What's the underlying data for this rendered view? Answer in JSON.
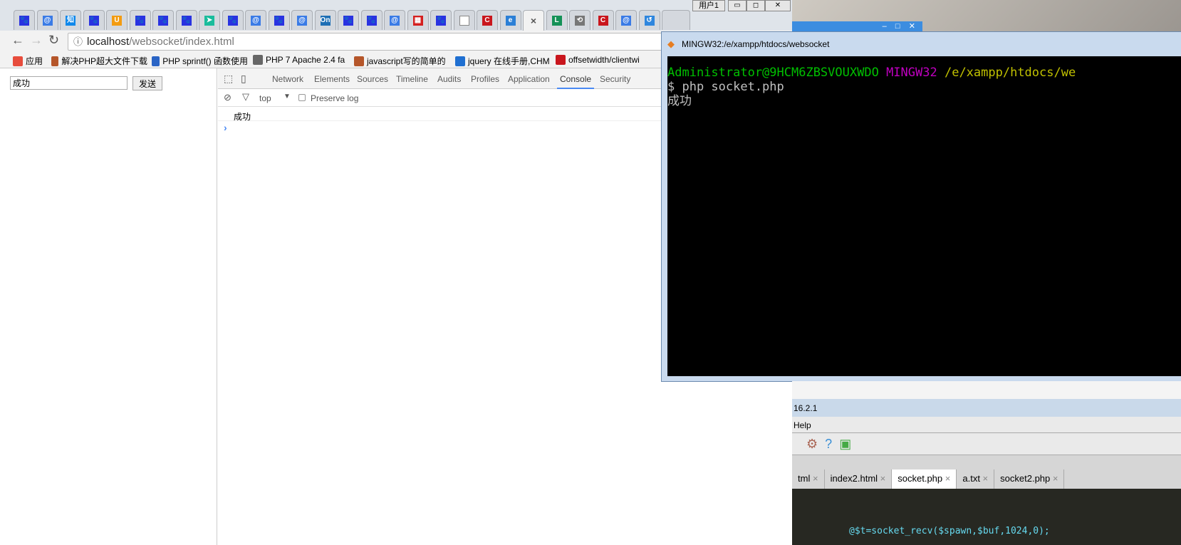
{
  "os": {
    "user_badge": "用户1",
    "minimize": "▭",
    "maximize": "◻",
    "close": "✕"
  },
  "browser": {
    "tabs": [
      {
        "icon": "baidu-paw-icon",
        "color": "#2932e1",
        "glyph": "🐾"
      },
      {
        "icon": "sogou-icon",
        "color": "#3a7be6",
        "glyph": "@"
      },
      {
        "icon": "zhihu-icon",
        "color": "#0f88eb",
        "glyph": "知"
      },
      {
        "icon": "baidu-paw-icon",
        "color": "#2932e1",
        "glyph": "🐾"
      },
      {
        "icon": "uc-icon",
        "color": "#f39c12",
        "glyph": "U"
      },
      {
        "icon": "baidu-paw-icon",
        "color": "#2932e1",
        "glyph": "🐾"
      },
      {
        "icon": "baidu-paw-icon",
        "color": "#2932e1",
        "glyph": "🐾"
      },
      {
        "icon": "baidu-paw-icon",
        "color": "#2932e1",
        "glyph": "🐾"
      },
      {
        "icon": "send-arrow-icon",
        "color": "#1abc9c",
        "glyph": "➤"
      },
      {
        "icon": "baidu-paw-icon",
        "color": "#2932e1",
        "glyph": "🐾"
      },
      {
        "icon": "sogou-icon",
        "color": "#3a7be6",
        "glyph": "@"
      },
      {
        "icon": "baidu-paw-icon",
        "color": "#2932e1",
        "glyph": "🐾"
      },
      {
        "icon": "sogou-icon",
        "color": "#3a7be6",
        "glyph": "@"
      },
      {
        "icon": "onenote-icon",
        "color": "#1e6fb5",
        "glyph": "On"
      },
      {
        "icon": "baidu-paw-icon",
        "color": "#2932e1",
        "glyph": "🐾"
      },
      {
        "icon": "baidu-paw-icon",
        "color": "#2932e1",
        "glyph": "🐾"
      },
      {
        "icon": "sogou-icon",
        "color": "#3a7be6",
        "glyph": "@"
      },
      {
        "icon": "colorful-icon",
        "color": "#d4201f",
        "glyph": "▦"
      },
      {
        "icon": "baidu-paw-icon",
        "color": "#2932e1",
        "glyph": "🐾"
      },
      {
        "icon": "document-icon",
        "color": "#ffffff",
        "glyph": ""
      },
      {
        "icon": "csdn-icon",
        "color": "#c9161d",
        "glyph": "C"
      },
      {
        "icon": "ie-icon",
        "color": "#2b7fd6",
        "glyph": "e"
      },
      {
        "icon": "close-icon",
        "color": "#f2f2f2",
        "glyph": "×",
        "active": true
      },
      {
        "icon": "l-icon",
        "color": "#149157",
        "glyph": "L"
      },
      {
        "icon": "history-icon",
        "color": "#777777",
        "glyph": "⟲"
      },
      {
        "icon": "csdn-icon",
        "color": "#c9161d",
        "glyph": "C"
      },
      {
        "icon": "sogou-icon",
        "color": "#3a7be6",
        "glyph": "@"
      },
      {
        "icon": "swirl-icon",
        "color": "#2e86de",
        "glyph": "↺"
      }
    ],
    "url_host": "localhost",
    "url_path": "/websocket/index.html",
    "bookmarks": [
      {
        "label": "应用",
        "color": "#e74c3c"
      },
      {
        "label": "解决PHP超大文件下载",
        "color": "#b5562a"
      },
      {
        "label": "PHP sprintf() 函数使用",
        "color": "#2a64c5"
      },
      {
        "label": "PHP 7 Apache 2.4 fa",
        "color": "#666666"
      },
      {
        "label": "javascript写的简单的",
        "color": "#b5562a"
      },
      {
        "label": "jquery 在线手册,CHM",
        "color": "#1f6fd1"
      },
      {
        "label": "offsetwidth/clientwi",
        "color": "#c9161d"
      }
    ]
  },
  "page": {
    "input_value": "成功",
    "send_label": "发送"
  },
  "devtools": {
    "tabs": [
      "Network",
      "Elements",
      "Sources",
      "Timeline",
      "Audits",
      "Profiles",
      "Application",
      "Console",
      "Security"
    ],
    "selected_tab": "Console",
    "context": "top",
    "preserve_log": "Preserve log",
    "log": [
      "成功"
    ],
    "prompt": "›"
  },
  "terminal": {
    "title": "MINGW32:/e/xampp/htdocs/websocket",
    "user_host": "Administrator@9HCM6ZBSVOUXWDO",
    "env": "MINGW32",
    "cwd": "/e/xampp/htdocs/we",
    "command": "$ php socket.php",
    "output": "成功"
  },
  "ide": {
    "version": "16.2.1",
    "menu": "Help",
    "tabs": [
      {
        "label": "tml"
      },
      {
        "label": "index2.html"
      },
      {
        "label": "socket.php",
        "active": true
      },
      {
        "label": "a.txt"
      },
      {
        "label": "socket2.php"
      }
    ],
    "code": "@$t=socket_recv($spawn,$buf,1024,0);"
  }
}
